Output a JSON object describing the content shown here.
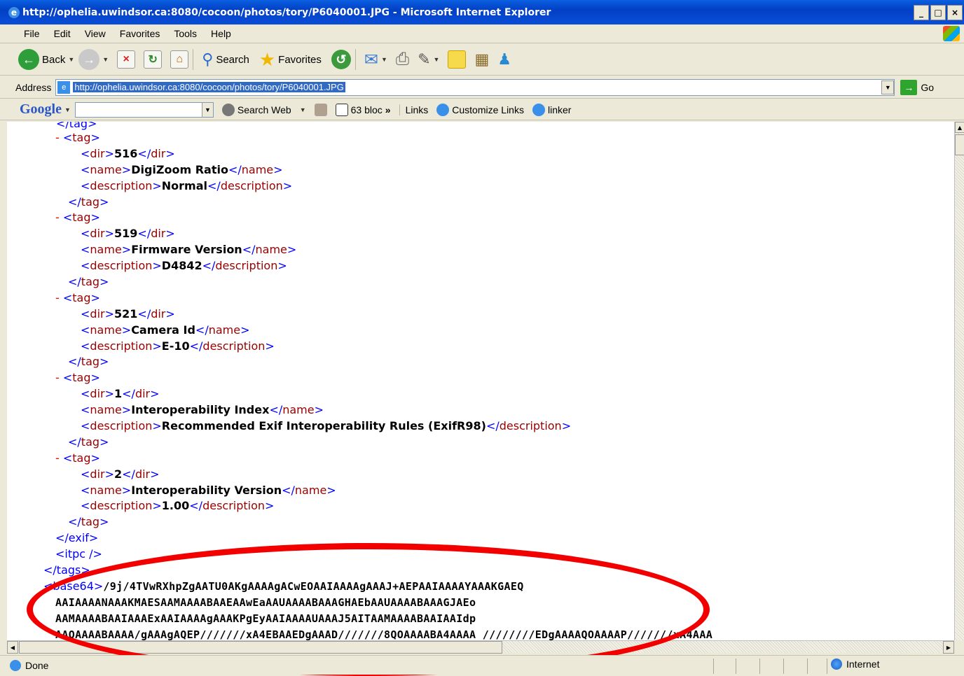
{
  "window": {
    "title": "http://ophelia.uwindsor.ca:8080/cocoon/photos/tory/P6040001.JPG - Microsoft Internet Explorer",
    "min": "_",
    "max": "□",
    "close": "×"
  },
  "menu": [
    "File",
    "Edit",
    "View",
    "Favorites",
    "Tools",
    "Help"
  ],
  "toolbar": {
    "back": "Back",
    "search": "Search",
    "favorites": "Favorites"
  },
  "address": {
    "label": "Address",
    "url": "http://ophelia.uwindsor.ca:8080/cocoon/photos/tory/P6040001.JPG",
    "go": "Go"
  },
  "google": {
    "logo": "Google",
    "search_web": "Search Web",
    "blocked": "63 bloc",
    "more": "»",
    "links": "Links",
    "customize": "Customize Links",
    "linker": "linker"
  },
  "xml": {
    "tags": [
      {
        "dir": "516",
        "name": "DigiZoom Ratio",
        "description": "Normal"
      },
      {
        "dir": "519",
        "name": "Firmware Version",
        "description": "D4842"
      },
      {
        "dir": "521",
        "name": "Camera Id",
        "description": "E-10"
      },
      {
        "dir": "1",
        "name": "Interoperability Index",
        "description": "Recommended Exif Interoperability Rules (ExifR98)"
      },
      {
        "dir": "2",
        "name": "Interoperability Version",
        "description": "1.00"
      }
    ],
    "close_exif": "</exif>",
    "itpc": "<itpc />",
    "close_tags": "</tags>",
    "base64_open": "<base64>",
    "base64_lines": [
      "/9j/4TVwRXhpZgAATU0AKgAAAAgACwEOAAIAAAAgAAAJ+AEPAAIAAAAYAAAKGAEQ",
      "AAIAAAANAAAKMAESAAMAAAABAAEAAwEaAAUAAAABAAAGHAEbAAUAAAABAAAGJAEo",
      "AAMAAAABAAIAAAExAAIAAAAgAAAKPgEyAAIAAAAUAAAJ5AITAAMAAAABAAIAAIdp",
      "AAQAAAABAAAA/gAAAgAQEP///////xA4EBAAEDgAAAD///////8QOAAAABA4AAAA ////////EDgAAAAQOAAAAP///////xA4AAA"
    ]
  },
  "status": {
    "text": "Done",
    "zone": "Internet"
  }
}
